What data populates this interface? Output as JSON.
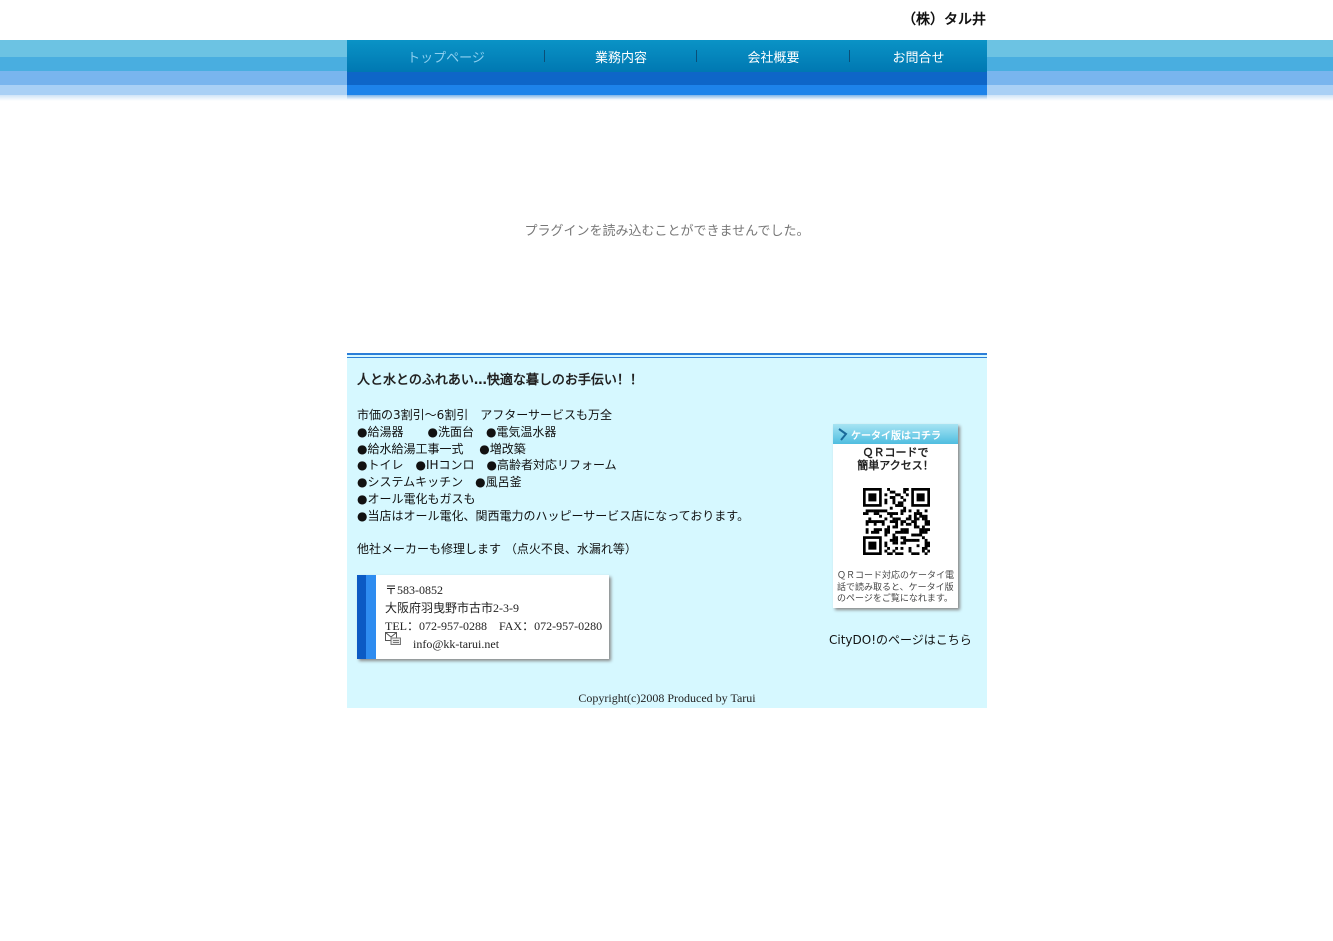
{
  "brand": "（株）タル井",
  "nav": {
    "items": [
      {
        "label": "トップページ",
        "active": true
      },
      {
        "label": "業務内容",
        "active": false
      },
      {
        "label": "会社概要",
        "active": false
      },
      {
        "label": "お問合せ",
        "active": false
      }
    ]
  },
  "main": {
    "plugin_message": "プラグインを読み込むことができませんでした。"
  },
  "footer": {
    "tagline": "人と水とのふれあい…快適な暮しのお手伝い！！",
    "description": "市価の3割引～6割引　アフターサービスも万全\n●給湯器　　●洗面台　●電気温水器\n●給水給湯工事一式　 ●増改築\n●トイレ　●IHコンロ　●高齢者対応リフォーム\n●システムキッチン　●風呂釜\n●オール電化もガスも\n●当店はオール電化、関西電力のハッピーサービス店になっております。\n\n他社メーカーも修理します （点火不良、水漏れ等）",
    "address": "〒583-0852\n大阪府羽曳野市古市2-3-9\nTEL：072-957-0288　FAX：072-957-0280",
    "email": "info@kk-tarui.net",
    "mobile": {
      "header": "ケータイ版はコチラ",
      "title": "ＱＲコードで\n簡単アクセス！",
      "note": "ＱＲコード対応のケータイ電話で読み取ると、ケータイ版のページをご覧になれます。"
    },
    "citydo_link": "CityDO!のページはこちら",
    "copyright": "Copyright(c)2008 Produced by Tarui"
  }
}
